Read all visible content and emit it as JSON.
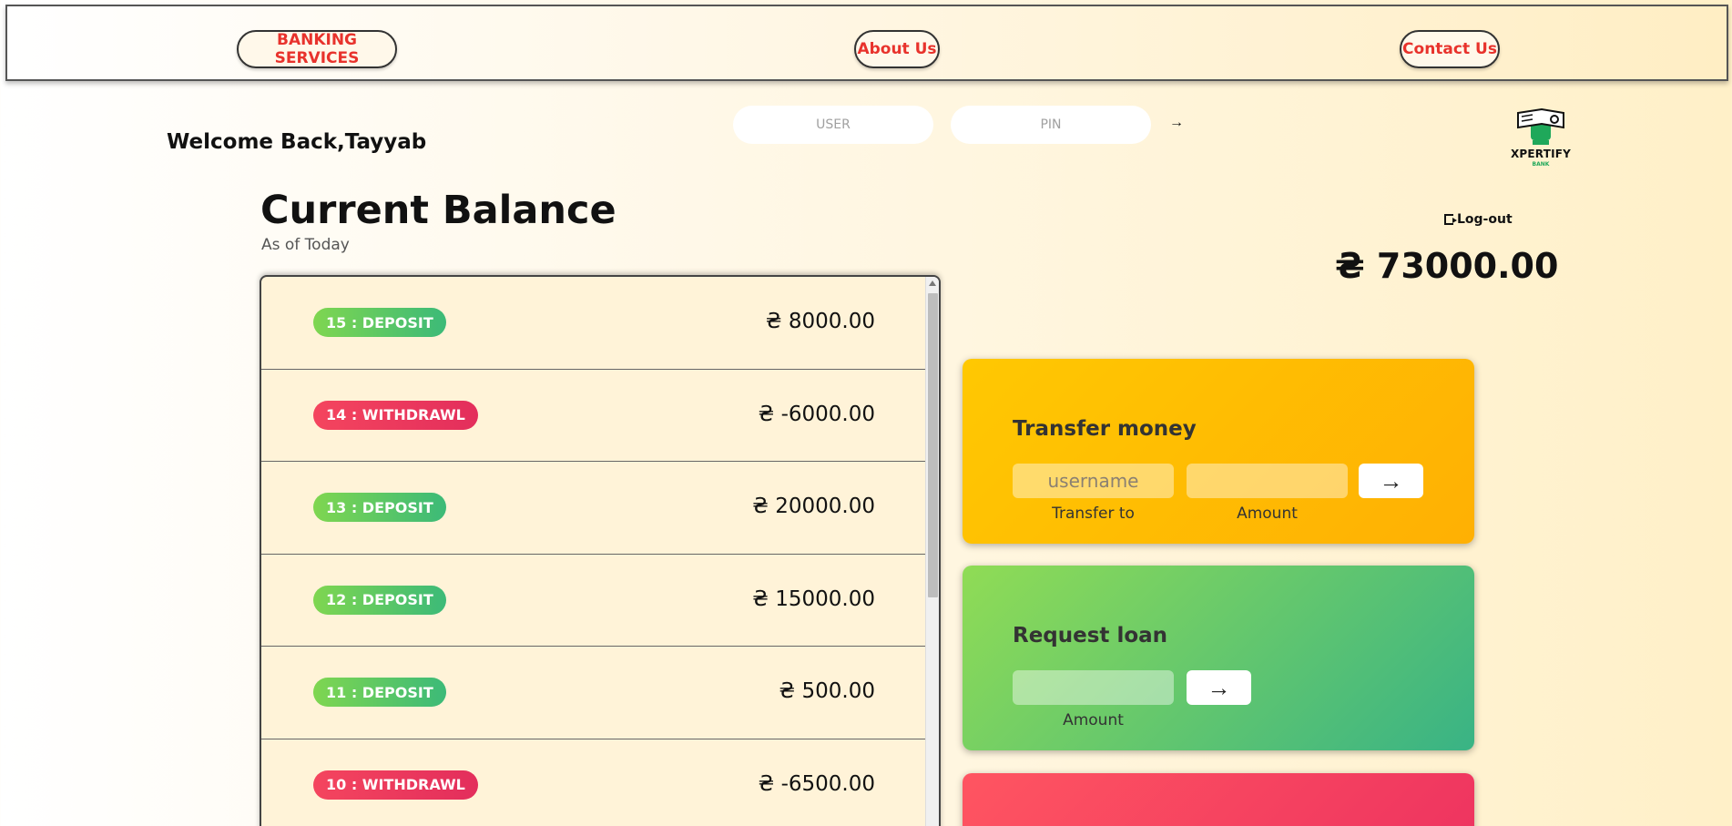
{
  "nav": {
    "banking": "BANKING SERVICES",
    "about": "About Us",
    "contact": "Contact Us"
  },
  "header": {
    "welcome": "Welcome Back,Tayyab",
    "user_placeholder": "USER",
    "pin_placeholder": "PIN",
    "login_arrow": "→"
  },
  "logo": {
    "name": "XPERTIFY",
    "sub": "BANK",
    "icon": "fist-money-icon"
  },
  "balance": {
    "title": "Current Balance",
    "subtitle": "As of Today",
    "amount": "₴ 73000.00",
    "logout": "Log-out"
  },
  "movements": [
    {
      "label": "15 : DEPOSIT",
      "type": "deposit",
      "value": "₴ 8000.00"
    },
    {
      "label": "14 : WITHDRAWL",
      "type": "withdrawal",
      "value": "₴ -6000.00"
    },
    {
      "label": "13 : DEPOSIT",
      "type": "deposit",
      "value": "₴ 20000.00"
    },
    {
      "label": "12 : DEPOSIT",
      "type": "deposit",
      "value": "₴ 15000.00"
    },
    {
      "label": "11 : DEPOSIT",
      "type": "deposit",
      "value": "₴ 500.00"
    },
    {
      "label": "10 : WITHDRAWL",
      "type": "withdrawal",
      "value": "₴ -6500.00"
    }
  ],
  "transfer": {
    "title": "Transfer money",
    "to_placeholder": "username",
    "amount_placeholder": "",
    "button": "→",
    "to_label": "Transfer to",
    "amount_label": "Amount"
  },
  "loan": {
    "title": "Request loan",
    "amount_placeholder": "",
    "button": "→",
    "amount_label": "Amount"
  },
  "colors": {
    "nav_text": "#e8322c",
    "deposit": "#5cc865",
    "withdrawal": "#ee3a5e",
    "transfer_card": "#ffbe02",
    "loan_card": "#6cc86a",
    "close_card": "#f6465f"
  }
}
